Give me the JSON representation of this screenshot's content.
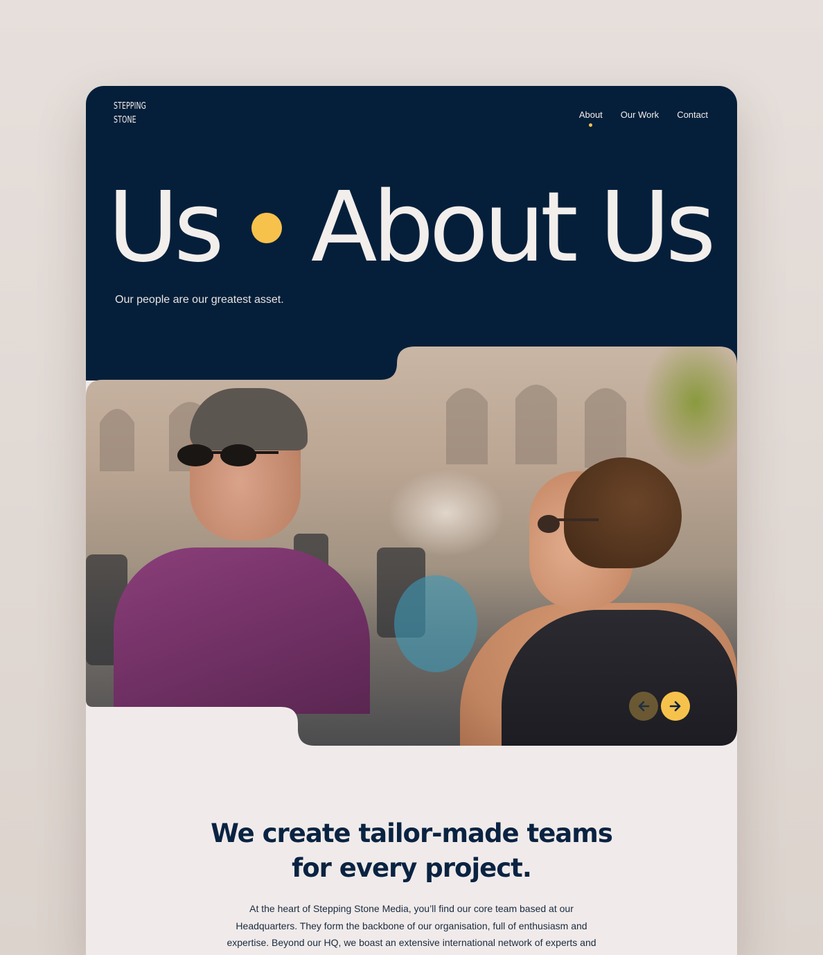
{
  "brand": {
    "logo_line1": "STEPPING",
    "logo_line2": "STONE"
  },
  "nav": {
    "items": [
      {
        "label": "About",
        "active": true
      },
      {
        "label": "Our Work"
      },
      {
        "label": "Contact"
      }
    ]
  },
  "hero": {
    "marquee_left": "t Us",
    "marquee_right": "About Us",
    "tagline": "Our people are our greatest asset."
  },
  "carousel": {
    "prev_icon": "arrow-left-icon",
    "next_icon": "arrow-right-icon"
  },
  "content": {
    "headline_line1": "We create tailor-made teams",
    "headline_line2": "for every project.",
    "body": "At the heart of Stepping Stone Media, you’ll find our core team based at our Headquarters. They form the backbone of our organisation, full of enthusiasm and expertise. Beyond our HQ, we boast an extensive international network of experts and"
  },
  "colors": {
    "navy": "#051f3a",
    "accent": "#f7c24c",
    "cream": "#f0ebea"
  }
}
